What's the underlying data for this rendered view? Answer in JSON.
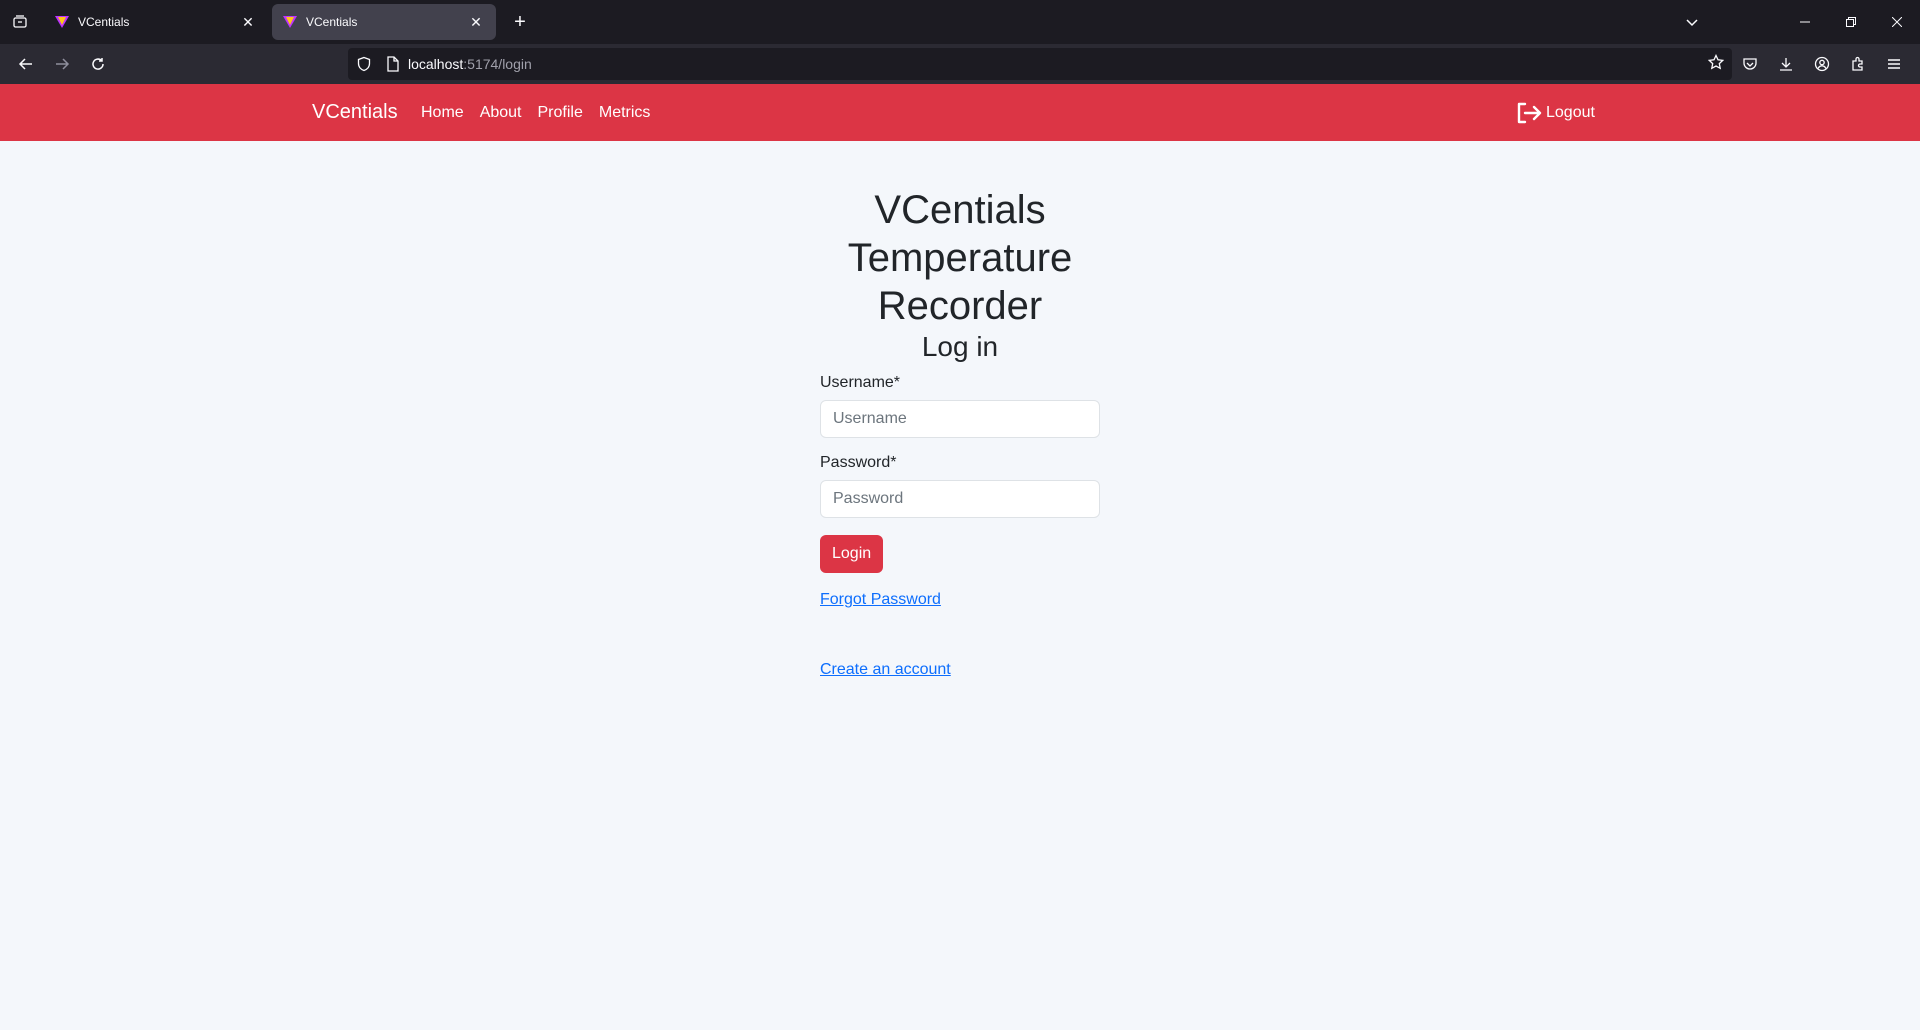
{
  "browser": {
    "tabs": [
      {
        "title": "VCentials",
        "active": false
      },
      {
        "title": "VCentials",
        "active": true
      }
    ],
    "url_host": "localhost",
    "url_path": ":5174/login"
  },
  "app": {
    "brand": "VCentials",
    "nav": [
      "Home",
      "About",
      "Profile",
      "Metrics"
    ],
    "logout": "Logout",
    "accent": "#dc3545"
  },
  "login": {
    "title_line1": "VCentials",
    "title_line2": "Temperature",
    "title_line3": "Recorder",
    "subtitle": "Log in",
    "username_label": "Username*",
    "username_placeholder": "Username",
    "password_label": "Password*",
    "password_placeholder": "Password",
    "login_button": "Login",
    "forgot_link": "Forgot Password",
    "create_link": "Create an account"
  }
}
